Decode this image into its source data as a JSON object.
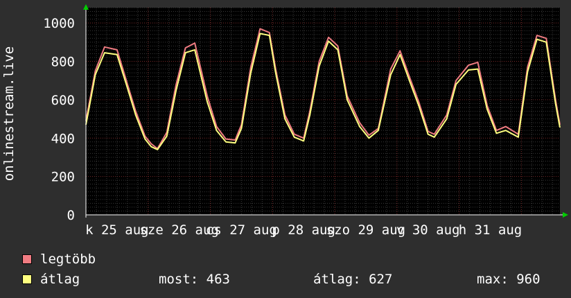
{
  "chart_data": {
    "type": "line",
    "ylabel": "onlinestream.live",
    "ylim": [
      0,
      1080
    ],
    "yticks": [
      0,
      200,
      400,
      600,
      800,
      1000
    ],
    "x_tick_labels": [
      "k 25 aug",
      "sze 26 aug",
      "cs 27 aug",
      "p 28 aug",
      "szo 29 aug",
      "v 30 aug",
      "h 31 aug"
    ],
    "x_range_days": [
      0,
      7.62
    ],
    "grid": true,
    "series": [
      {
        "name": "legtöbb",
        "color": "#f07c82",
        "x": [
          0,
          0.15,
          0.3,
          0.5,
          0.65,
          0.8,
          0.95,
          1.05,
          1.15,
          1.3,
          1.45,
          1.6,
          1.75,
          1.95,
          2.1,
          2.25,
          2.4,
          2.5,
          2.65,
          2.8,
          2.95,
          3.05,
          3.2,
          3.35,
          3.5,
          3.6,
          3.75,
          3.9,
          4.05,
          4.2,
          4.4,
          4.55,
          4.7,
          4.9,
          5.05,
          5.2,
          5.35,
          5.5,
          5.6,
          5.8,
          5.95,
          6.15,
          6.3,
          6.45,
          6.6,
          6.75,
          6.95,
          7.1,
          7.25,
          7.4,
          7.55,
          7.62
        ],
        "y": [
          490,
          750,
          875,
          860,
          700,
          540,
          410,
          370,
          345,
          430,
          680,
          870,
          895,
          620,
          460,
          395,
          390,
          470,
          770,
          970,
          950,
          760,
          520,
          420,
          400,
          540,
          800,
          925,
          880,
          620,
          480,
          415,
          450,
          760,
          855,
          720,
          590,
          435,
          420,
          520,
          700,
          780,
          795,
          570,
          440,
          460,
          420,
          770,
          935,
          920,
          600,
          470
        ]
      },
      {
        "name": "átlag",
        "color": "#ffff80",
        "x": [
          0,
          0.15,
          0.3,
          0.5,
          0.65,
          0.8,
          0.95,
          1.05,
          1.15,
          1.3,
          1.45,
          1.6,
          1.75,
          1.95,
          2.1,
          2.25,
          2.4,
          2.5,
          2.65,
          2.8,
          2.95,
          3.05,
          3.2,
          3.35,
          3.5,
          3.6,
          3.75,
          3.9,
          4.05,
          4.2,
          4.4,
          4.55,
          4.7,
          4.9,
          5.05,
          5.2,
          5.35,
          5.5,
          5.6,
          5.8,
          5.95,
          6.15,
          6.3,
          6.45,
          6.6,
          6.75,
          6.95,
          7.1,
          7.25,
          7.4,
          7.55,
          7.62
        ],
        "y": [
          470,
          730,
          845,
          835,
          680,
          520,
          395,
          355,
          340,
          410,
          650,
          845,
          860,
          590,
          440,
          380,
          375,
          450,
          740,
          945,
          935,
          740,
          500,
          405,
          385,
          520,
          775,
          905,
          860,
          600,
          460,
          400,
          440,
          730,
          835,
          700,
          570,
          420,
          405,
          500,
          680,
          755,
          760,
          550,
          425,
          440,
          405,
          745,
          915,
          900,
          580,
          455
        ]
      }
    ]
  },
  "legend": {
    "items": [
      {
        "label": "legtöbb",
        "color": "#f07c82"
      },
      {
        "label": "átlag",
        "color": "#ffff80"
      }
    ]
  },
  "stats": {
    "most": "most: 463",
    "atlag": "átlag: 627",
    "max": "max: 960"
  }
}
